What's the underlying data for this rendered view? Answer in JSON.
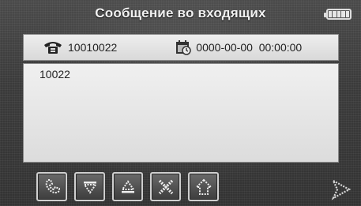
{
  "title": "Сообщение во входящих",
  "battery": {
    "cells": 5,
    "level": 1.0
  },
  "message": {
    "number": "10010022",
    "datetime": "0000-00-00  00:00:00",
    "body": "10022"
  },
  "icons": {
    "header": [
      "phone-icon",
      "calendar-clock-icon"
    ],
    "toolbar": [
      "call-back-icon",
      "arrow-down-icon",
      "arrow-up-icon",
      "delete-icon",
      "home-icon"
    ],
    "navigation": [
      "next-arrow-icon"
    ]
  }
}
